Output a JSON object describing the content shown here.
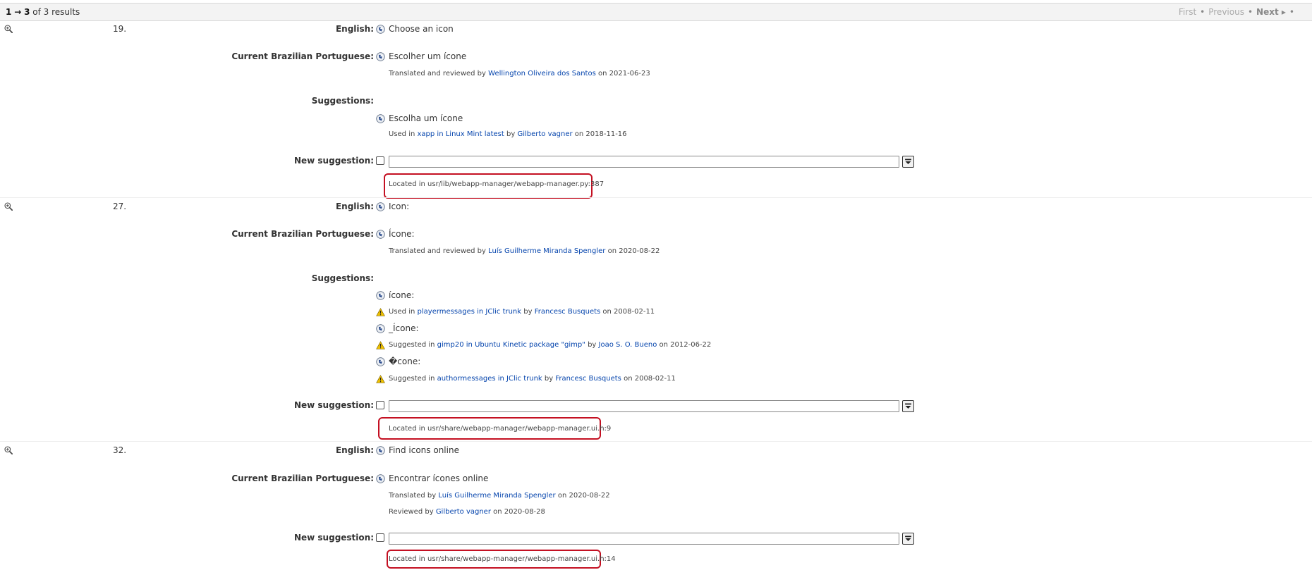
{
  "header": {
    "range_start": "1",
    "arrow": "→",
    "range_end": "3",
    "of_text": "of 3 results",
    "first": "First",
    "previous": "Previous",
    "next": "Next",
    "dot": "•"
  },
  "labels": {
    "english": "English:",
    "current": "Current Brazilian Portuguese:",
    "suggestions": "Suggestions:",
    "new_suggestion": "New suggestion:"
  },
  "entries": [
    {
      "number": "19.",
      "english": "Choose an icon",
      "current": "Escolher um ícone",
      "current_meta": {
        "prefix": "Translated and reviewed by",
        "person": "Wellington Oliveira dos Santos",
        "suffix": "on 2021-06-23"
      },
      "suggestions": [
        {
          "text": "Escolha um ícone",
          "prefix": "Used in",
          "where": "xapp in Linux Mint latest",
          "by": "by",
          "person": "Gilberto vagner",
          "suffix": "on 2018-11-16"
        }
      ],
      "location": "Located in usr/lib/webapp-manager/webapp-manager.py:387"
    },
    {
      "number": "27.",
      "english": "Icon:",
      "current": "Ícone:",
      "current_meta": {
        "prefix": "Translated and reviewed by",
        "person": "Luís Guilherme Miranda Spengler",
        "suffix": "on 2020-08-22"
      },
      "suggestions": [
        {
          "text": "ícone:",
          "prefix": "Used in",
          "where": "playermessages in JClic trunk",
          "by": "by",
          "person": "Francesc Busquets",
          "suffix": "on 2008-02-11"
        },
        {
          "text": "_Ícone:",
          "prefix": "Suggested in",
          "where": "gimp20 in Ubuntu Kinetic package \"gimp\"",
          "by": "by",
          "person": "Joao S. O. Bueno",
          "suffix": "on 2012-06-22"
        },
        {
          "text": "�cone:",
          "prefix": "Suggested in",
          "where": "authormessages in JClic trunk",
          "by": "by",
          "person": "Francesc Busquets",
          "suffix": "on 2008-02-11"
        }
      ],
      "location": "Located in usr/share/webapp-manager/webapp-manager.ui.h:9"
    },
    {
      "number": "32.",
      "english": "Find icons online",
      "current": "Encontrar ícones online",
      "current_meta": {
        "prefix": "Translated by",
        "person": "Luís Guilherme Miranda Spengler",
        "suffix": "on 2020-08-22"
      },
      "reviewed_meta": {
        "prefix": "Reviewed by",
        "person": "Gilberto vagner",
        "suffix": "on 2020-08-28"
      },
      "location": "Located in usr/share/webapp-manager/webapp-manager.ui.h:14"
    }
  ],
  "icons": {
    "zoom": "zoom-in-icon",
    "globe": "globe-icon",
    "warning": "warning-icon",
    "dropdown": "dropdown-icon"
  },
  "colors": {
    "link": "#0645ad",
    "highlight": "#c41022",
    "warning": "#f2c300"
  }
}
